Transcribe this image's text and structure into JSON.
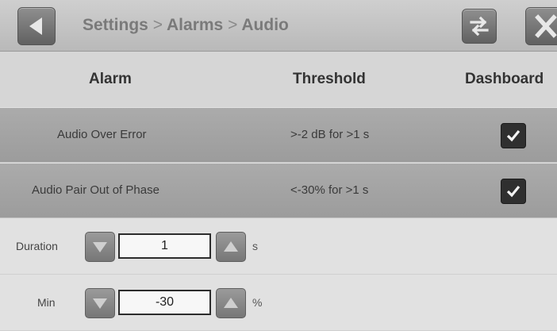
{
  "header": {
    "breadcrumb": [
      "Settings",
      "Alarms",
      "Audio"
    ],
    "separator": ">",
    "back_icon": "back-arrow-icon",
    "swap_icon": "swap-arrows-icon",
    "close_icon": "close-x-icon"
  },
  "table": {
    "columns": [
      "Alarm",
      "Threshold",
      "Dashboard"
    ],
    "rows": [
      {
        "alarm": "Audio Over Error",
        "threshold": ">-2 dB for >1 s",
        "dashboard": true
      },
      {
        "alarm": "Audio Pair Out of Phase",
        "threshold": "<-30% for >1 s",
        "dashboard": true
      }
    ]
  },
  "controls": [
    {
      "label": "Duration",
      "value": "1",
      "unit": "s"
    },
    {
      "label": "Min",
      "value": "-30",
      "unit": "%"
    }
  ],
  "colors": {
    "header_bg": "#c4c4c4",
    "row_bg": "#a3a3a3",
    "checkbox": "#2f2f2f"
  }
}
